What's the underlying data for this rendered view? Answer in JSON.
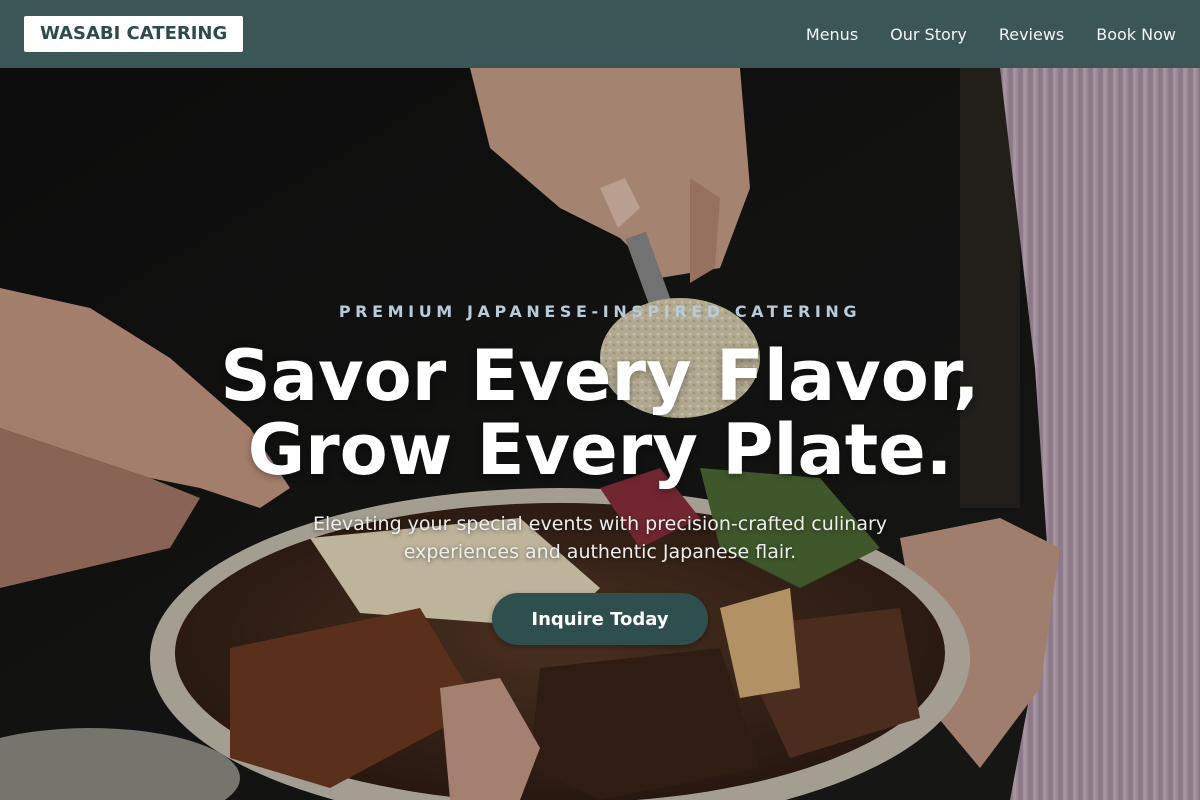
{
  "header": {
    "logo": "WASABI CATERING",
    "nav": [
      {
        "label": "Menus"
      },
      {
        "label": "Our Story"
      },
      {
        "label": "Reviews"
      },
      {
        "label": "Book Now"
      }
    ]
  },
  "hero": {
    "eyebrow": "PREMIUM JAPANESE-INSPIRED CATERING",
    "headline_line1": "Savor Every Flavor,",
    "headline_line2": "Grow Every Plate.",
    "subtitle_line1": "Elevating your special events with precision-crafted culinary",
    "subtitle_line2": "experiences and authentic Japanese flair.",
    "cta_label": "Inquire Today"
  },
  "colors": {
    "header_bg": "#3a5656",
    "logo_text": "#2f4a4a",
    "eyebrow": "#b7cbd9",
    "cta_bg": "#2f4e4e"
  }
}
